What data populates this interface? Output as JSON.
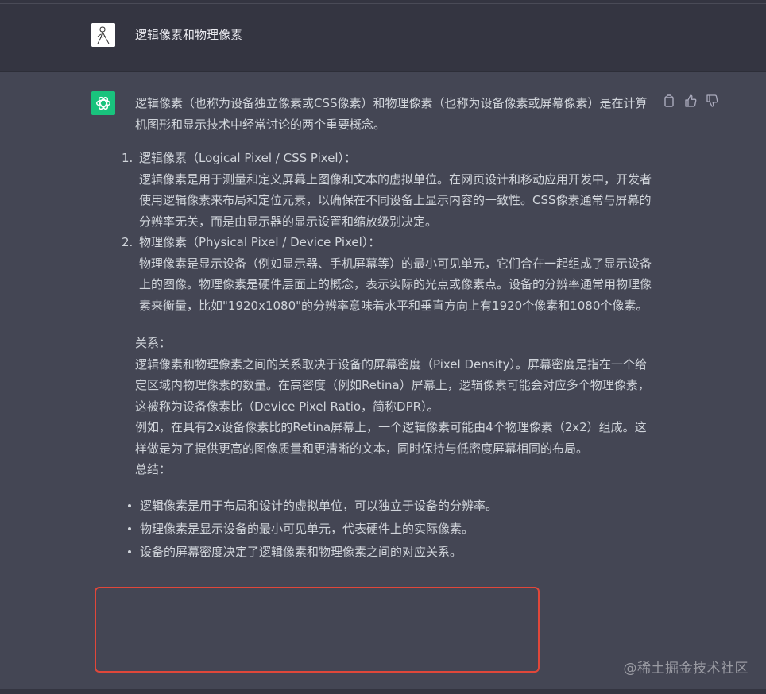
{
  "user": {
    "message": "逻辑像素和物理像素"
  },
  "assistant": {
    "intro": "逻辑像素（也称为设备独立像素或CSS像素）和物理像素（也称为设备像素或屏幕像素）是在计算机图形和显示技术中经常讨论的两个重要概念。",
    "items": [
      {
        "num": "1.",
        "title": "逻辑像素（Logical Pixel / CSS Pixel）：",
        "body": "逻辑像素是用于测量和定义屏幕上图像和文本的虚拟单位。在网页设计和移动应用开发中，开发者使用逻辑像素来布局和定位元素，以确保在不同设备上显示内容的一致性。CSS像素通常与屏幕的分辨率无关，而是由显示器的显示设置和缩放级别决定。"
      },
      {
        "num": "2.",
        "title": "物理像素（Physical Pixel / Device Pixel）：",
        "body": "物理像素是显示设备（例如显示器、手机屏幕等）的最小可见单元，它们合在一起组成了显示设备上的图像。物理像素是硬件层面上的概念，表示实际的光点或像素点。设备的分辨率通常用物理像素来衡量，比如\"1920x1080\"的分辨率意味着水平和垂直方向上有1920个像素和1080个像素。"
      }
    ],
    "relation_head": "关系：",
    "relation_body": "逻辑像素和物理像素之间的关系取决于设备的屏幕密度（Pixel Density）。屏幕密度是指在一个给定区域内物理像素的数量。在高密度（例如Retina）屏幕上，逻辑像素可能会对应多个物理像素，这被称为设备像素比（Device Pixel Ratio，简称DPR）。",
    "example": "例如，在具有2x设备像素比的Retina屏幕上，一个逻辑像素可能由4个物理像素（2x2）组成。这样做是为了提供更高的图像质量和更清晰的文本，同时保持与低密度屏幕相同的布局。",
    "summary_head": "总结：",
    "bullets": [
      "逻辑像素是用于布局和设计的虚拟单位，可以独立于设备的分辨率。",
      "物理像素是显示设备的最小可见单元，代表硬件上的实际像素。",
      "设备的屏幕密度决定了逻辑像素和物理像素之间的对应关系。"
    ]
  },
  "icons": {
    "copy": "clipboard-icon",
    "like": "thumbs-up-icon",
    "dislike": "thumbs-down-icon",
    "bot": "openai-logo-icon"
  },
  "colors": {
    "bot_avatar": "#19c37d",
    "highlight": "#e0473a"
  },
  "watermark": "@稀土掘金技术社区"
}
